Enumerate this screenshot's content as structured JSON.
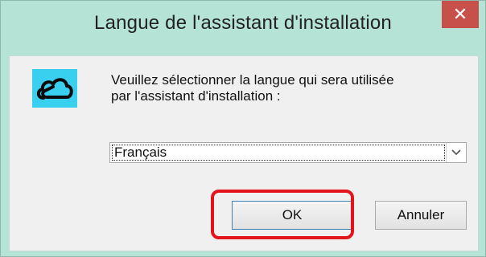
{
  "window": {
    "title": "Langue de l'assistant d'installation",
    "close_glyph": "✕"
  },
  "icons": {
    "app": "cloud-logo-icon",
    "close": "close-icon",
    "dropdown": "chevron-down-icon"
  },
  "message": {
    "line1": "Veuillez sélectionner la langue qui sera utilisée",
    "line2": "par l'assistant d'installation :"
  },
  "language_select": {
    "selected": "Français"
  },
  "buttons": {
    "ok": "OK",
    "cancel": "Annuler"
  },
  "colors": {
    "frame": "#b5e3d6",
    "close_button": "#c7504a",
    "highlight": "#e3141c",
    "icon_background": "#39d0f0"
  }
}
